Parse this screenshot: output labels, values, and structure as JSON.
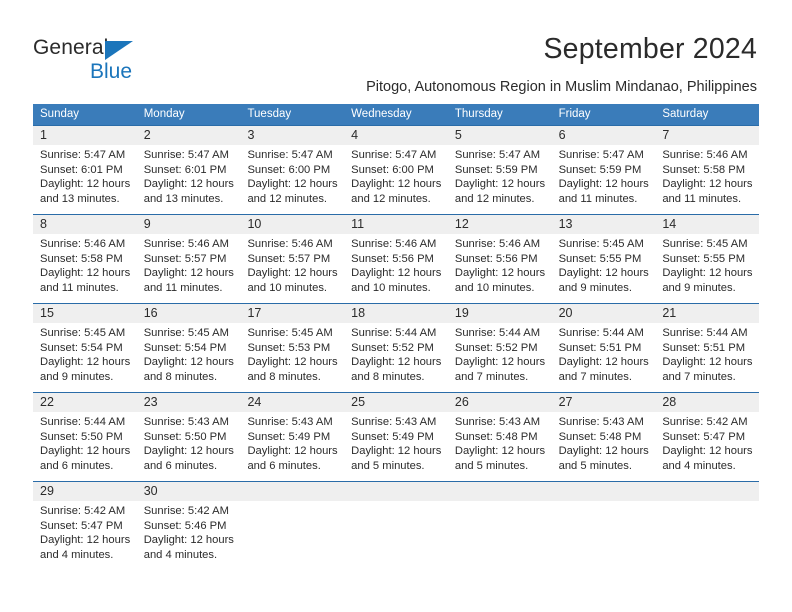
{
  "brand": {
    "name_part1": "General",
    "name_part2": "Blue",
    "triangle_color": "#1b75bb",
    "text_color": "#2b2b2b"
  },
  "header": {
    "title": "September 2024",
    "subtitle": "Pitogo, Autonomous Region in Muslim Mindanao, Philippines"
  },
  "colors": {
    "header_blue": "#3a7cba",
    "row_divider_blue": "#2a6ca8",
    "day_band_gray": "#efefef",
    "text": "#2b2b2b"
  },
  "calendar": {
    "weekdays": [
      "Sunday",
      "Monday",
      "Tuesday",
      "Wednesday",
      "Thursday",
      "Friday",
      "Saturday"
    ],
    "weeks": [
      [
        {
          "day": "1",
          "sunrise": "Sunrise: 5:47 AM",
          "sunset": "Sunset: 6:01 PM",
          "daylight1": "Daylight: 12 hours",
          "daylight2": "and 13 minutes."
        },
        {
          "day": "2",
          "sunrise": "Sunrise: 5:47 AM",
          "sunset": "Sunset: 6:01 PM",
          "daylight1": "Daylight: 12 hours",
          "daylight2": "and 13 minutes."
        },
        {
          "day": "3",
          "sunrise": "Sunrise: 5:47 AM",
          "sunset": "Sunset: 6:00 PM",
          "daylight1": "Daylight: 12 hours",
          "daylight2": "and 12 minutes."
        },
        {
          "day": "4",
          "sunrise": "Sunrise: 5:47 AM",
          "sunset": "Sunset: 6:00 PM",
          "daylight1": "Daylight: 12 hours",
          "daylight2": "and 12 minutes."
        },
        {
          "day": "5",
          "sunrise": "Sunrise: 5:47 AM",
          "sunset": "Sunset: 5:59 PM",
          "daylight1": "Daylight: 12 hours",
          "daylight2": "and 12 minutes."
        },
        {
          "day": "6",
          "sunrise": "Sunrise: 5:47 AM",
          "sunset": "Sunset: 5:59 PM",
          "daylight1": "Daylight: 12 hours",
          "daylight2": "and 11 minutes."
        },
        {
          "day": "7",
          "sunrise": "Sunrise: 5:46 AM",
          "sunset": "Sunset: 5:58 PM",
          "daylight1": "Daylight: 12 hours",
          "daylight2": "and 11 minutes."
        }
      ],
      [
        {
          "day": "8",
          "sunrise": "Sunrise: 5:46 AM",
          "sunset": "Sunset: 5:58 PM",
          "daylight1": "Daylight: 12 hours",
          "daylight2": "and 11 minutes."
        },
        {
          "day": "9",
          "sunrise": "Sunrise: 5:46 AM",
          "sunset": "Sunset: 5:57 PM",
          "daylight1": "Daylight: 12 hours",
          "daylight2": "and 11 minutes."
        },
        {
          "day": "10",
          "sunrise": "Sunrise: 5:46 AM",
          "sunset": "Sunset: 5:57 PM",
          "daylight1": "Daylight: 12 hours",
          "daylight2": "and 10 minutes."
        },
        {
          "day": "11",
          "sunrise": "Sunrise: 5:46 AM",
          "sunset": "Sunset: 5:56 PM",
          "daylight1": "Daylight: 12 hours",
          "daylight2": "and 10 minutes."
        },
        {
          "day": "12",
          "sunrise": "Sunrise: 5:46 AM",
          "sunset": "Sunset: 5:56 PM",
          "daylight1": "Daylight: 12 hours",
          "daylight2": "and 10 minutes."
        },
        {
          "day": "13",
          "sunrise": "Sunrise: 5:45 AM",
          "sunset": "Sunset: 5:55 PM",
          "daylight1": "Daylight: 12 hours",
          "daylight2": "and 9 minutes."
        },
        {
          "day": "14",
          "sunrise": "Sunrise: 5:45 AM",
          "sunset": "Sunset: 5:55 PM",
          "daylight1": "Daylight: 12 hours",
          "daylight2": "and 9 minutes."
        }
      ],
      [
        {
          "day": "15",
          "sunrise": "Sunrise: 5:45 AM",
          "sunset": "Sunset: 5:54 PM",
          "daylight1": "Daylight: 12 hours",
          "daylight2": "and 9 minutes."
        },
        {
          "day": "16",
          "sunrise": "Sunrise: 5:45 AM",
          "sunset": "Sunset: 5:54 PM",
          "daylight1": "Daylight: 12 hours",
          "daylight2": "and 8 minutes."
        },
        {
          "day": "17",
          "sunrise": "Sunrise: 5:45 AM",
          "sunset": "Sunset: 5:53 PM",
          "daylight1": "Daylight: 12 hours",
          "daylight2": "and 8 minutes."
        },
        {
          "day": "18",
          "sunrise": "Sunrise: 5:44 AM",
          "sunset": "Sunset: 5:52 PM",
          "daylight1": "Daylight: 12 hours",
          "daylight2": "and 8 minutes."
        },
        {
          "day": "19",
          "sunrise": "Sunrise: 5:44 AM",
          "sunset": "Sunset: 5:52 PM",
          "daylight1": "Daylight: 12 hours",
          "daylight2": "and 7 minutes."
        },
        {
          "day": "20",
          "sunrise": "Sunrise: 5:44 AM",
          "sunset": "Sunset: 5:51 PM",
          "daylight1": "Daylight: 12 hours",
          "daylight2": "and 7 minutes."
        },
        {
          "day": "21",
          "sunrise": "Sunrise: 5:44 AM",
          "sunset": "Sunset: 5:51 PM",
          "daylight1": "Daylight: 12 hours",
          "daylight2": "and 7 minutes."
        }
      ],
      [
        {
          "day": "22",
          "sunrise": "Sunrise: 5:44 AM",
          "sunset": "Sunset: 5:50 PM",
          "daylight1": "Daylight: 12 hours",
          "daylight2": "and 6 minutes."
        },
        {
          "day": "23",
          "sunrise": "Sunrise: 5:43 AM",
          "sunset": "Sunset: 5:50 PM",
          "daylight1": "Daylight: 12 hours",
          "daylight2": "and 6 minutes."
        },
        {
          "day": "24",
          "sunrise": "Sunrise: 5:43 AM",
          "sunset": "Sunset: 5:49 PM",
          "daylight1": "Daylight: 12 hours",
          "daylight2": "and 6 minutes."
        },
        {
          "day": "25",
          "sunrise": "Sunrise: 5:43 AM",
          "sunset": "Sunset: 5:49 PM",
          "daylight1": "Daylight: 12 hours",
          "daylight2": "and 5 minutes."
        },
        {
          "day": "26",
          "sunrise": "Sunrise: 5:43 AM",
          "sunset": "Sunset: 5:48 PM",
          "daylight1": "Daylight: 12 hours",
          "daylight2": "and 5 minutes."
        },
        {
          "day": "27",
          "sunrise": "Sunrise: 5:43 AM",
          "sunset": "Sunset: 5:48 PM",
          "daylight1": "Daylight: 12 hours",
          "daylight2": "and 5 minutes."
        },
        {
          "day": "28",
          "sunrise": "Sunrise: 5:42 AM",
          "sunset": "Sunset: 5:47 PM",
          "daylight1": "Daylight: 12 hours",
          "daylight2": "and 4 minutes."
        }
      ],
      [
        {
          "day": "29",
          "sunrise": "Sunrise: 5:42 AM",
          "sunset": "Sunset: 5:47 PM",
          "daylight1": "Daylight: 12 hours",
          "daylight2": "and 4 minutes."
        },
        {
          "day": "30",
          "sunrise": "Sunrise: 5:42 AM",
          "sunset": "Sunset: 5:46 PM",
          "daylight1": "Daylight: 12 hours",
          "daylight2": "and 4 minutes."
        },
        {
          "day": "",
          "sunrise": "",
          "sunset": "",
          "daylight1": "",
          "daylight2": ""
        },
        {
          "day": "",
          "sunrise": "",
          "sunset": "",
          "daylight1": "",
          "daylight2": ""
        },
        {
          "day": "",
          "sunrise": "",
          "sunset": "",
          "daylight1": "",
          "daylight2": ""
        },
        {
          "day": "",
          "sunrise": "",
          "sunset": "",
          "daylight1": "",
          "daylight2": ""
        },
        {
          "day": "",
          "sunrise": "",
          "sunset": "",
          "daylight1": "",
          "daylight2": ""
        }
      ]
    ]
  }
}
